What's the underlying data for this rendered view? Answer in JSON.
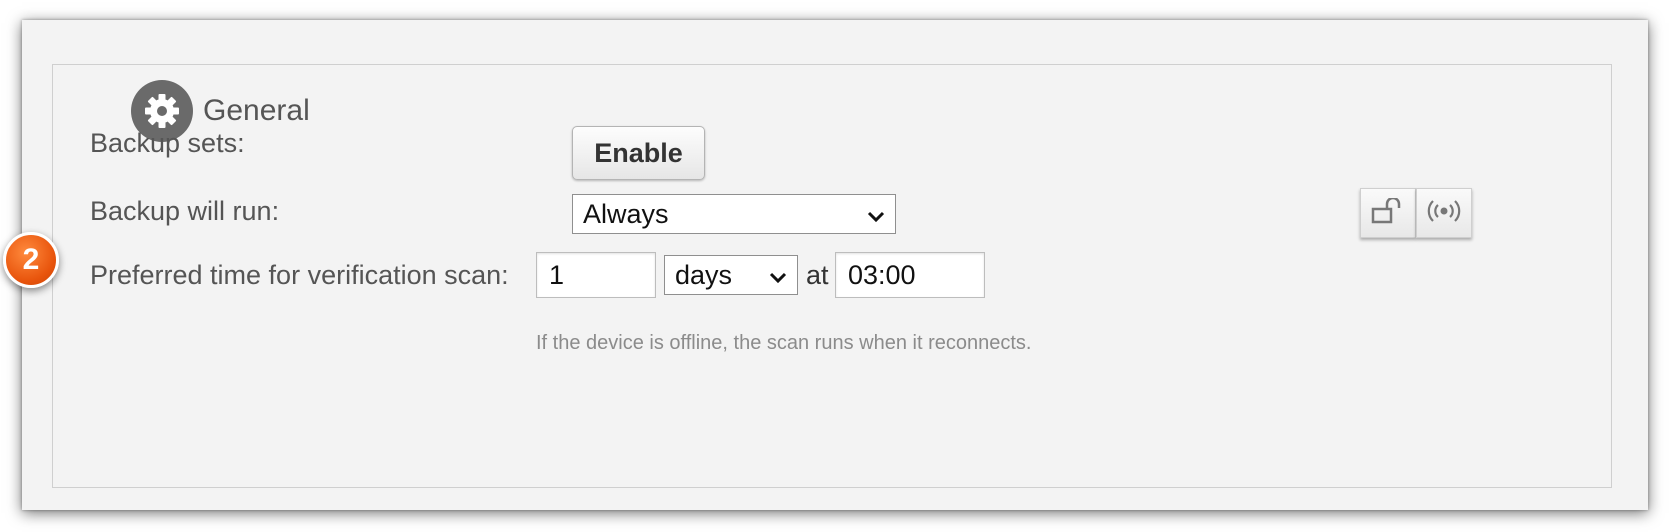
{
  "section": {
    "title": "General"
  },
  "fields": {
    "backup_sets": {
      "label": "Backup sets:",
      "button": "Enable"
    },
    "backup_will_run": {
      "label": "Backup will run:",
      "selected": "Always"
    },
    "verification_scan": {
      "label": "Preferred time for verification scan:",
      "interval_value": "1",
      "unit_selected": "days",
      "at_label": "at",
      "time_value": "03:00",
      "hint": "If the device is offline, the scan runs when it reconnects."
    }
  },
  "callout_badge": "2",
  "icons": {
    "lock": "unlock-icon",
    "broadcast": "broadcast-icon",
    "section": "gear-icon"
  },
  "colors": {
    "panel_bg": "#f3f3f3",
    "badge": "#e8540c",
    "text": "#555555",
    "hint": "#8b8b8b"
  }
}
